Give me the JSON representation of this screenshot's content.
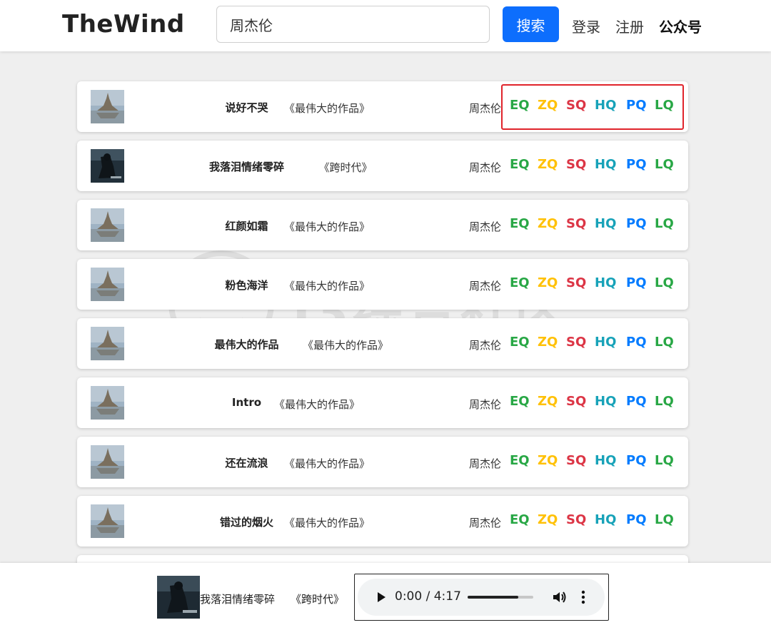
{
  "header": {
    "logo": "TheWind",
    "search_value": "周杰伦",
    "search_button": "搜索",
    "nav": {
      "login": "登录",
      "register": "注册",
      "public_account": "公众号"
    }
  },
  "quality_labels": [
    "EQ",
    "ZQ",
    "SQ",
    "HQ",
    "PQ",
    "LQ"
  ],
  "quality_colors": {
    "EQ": "#28a745",
    "ZQ": "#ffc107",
    "SQ": "#dc3545",
    "HQ": "#17a2b8",
    "PQ": "#007bff",
    "LQ": "#28a745"
  },
  "songs": [
    {
      "title": "说好不哭",
      "album": "《最伟大的作品》",
      "artist": "周杰伦",
      "cover": "castle"
    },
    {
      "title": "我落泪情绪零碎",
      "album": "《跨时代》",
      "artist": "周杰伦",
      "cover": "dark"
    },
    {
      "title": "红颜如霜",
      "album": "《最伟大的作品》",
      "artist": "周杰伦",
      "cover": "castle"
    },
    {
      "title": "粉色海洋",
      "album": "《最伟大的作品》",
      "artist": "周杰伦",
      "cover": "castle"
    },
    {
      "title": "最伟大的作品",
      "album": "《最伟大的作品》",
      "artist": "周杰伦",
      "cover": "castle"
    },
    {
      "title": "Intro",
      "album": "《最伟大的作品》",
      "artist": "周杰伦",
      "cover": "castle"
    },
    {
      "title": "还在流浪",
      "album": "《最伟大的作品》",
      "artist": "周杰伦",
      "cover": "castle"
    },
    {
      "title": "错过的烟火",
      "album": "《最伟大的作品》",
      "artist": "周杰伦",
      "cover": "castle"
    }
  ],
  "watermark": {
    "text": "i3综合社区",
    "url": "www.i3zh.com"
  },
  "player": {
    "title": "我落泪情绪零碎",
    "album": "《跨时代》",
    "time": "0:00 / 4:17",
    "progress_fraction": 0.77
  }
}
